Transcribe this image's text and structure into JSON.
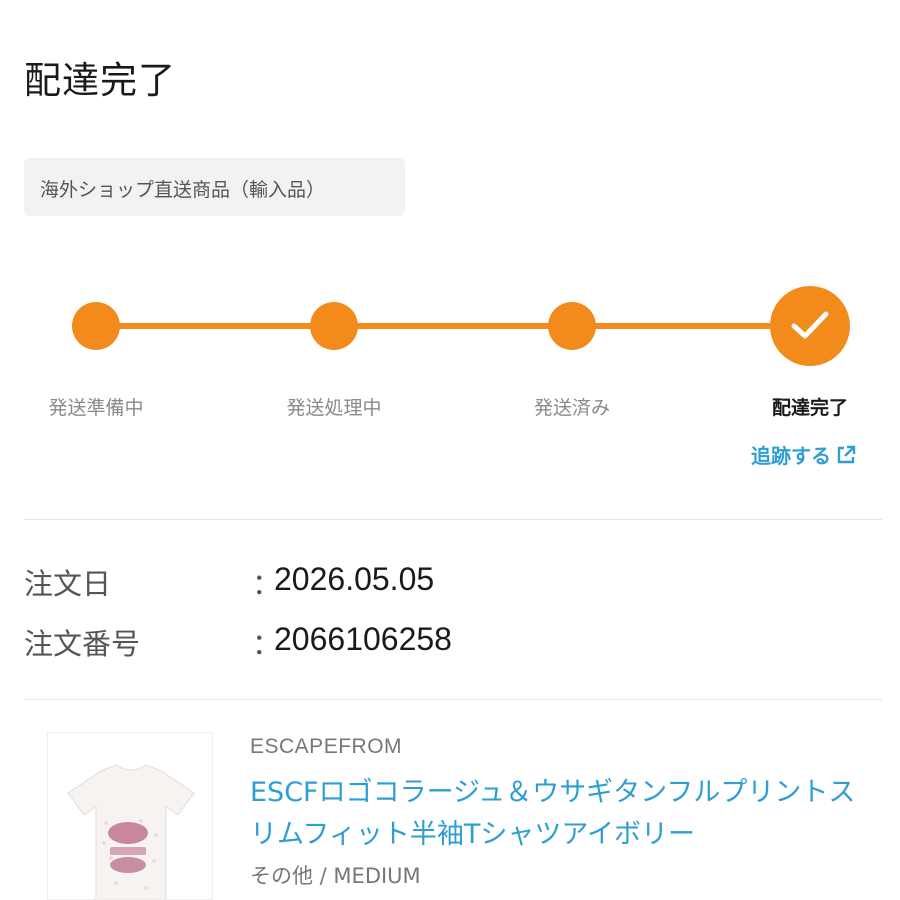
{
  "page": {
    "title": "配達完了"
  },
  "shop_tag": {
    "label": "海外ショップ直送商品（輸入品）"
  },
  "progress": {
    "steps": [
      {
        "label": "発送準備中",
        "state": "done"
      },
      {
        "label": "発送処理中",
        "state": "done"
      },
      {
        "label": "発送済み",
        "state": "done"
      },
      {
        "label": "配達完了",
        "state": "current"
      }
    ],
    "track_label": "追跡する",
    "accent_color": "#f28a1c",
    "link_color": "#2f9ed4"
  },
  "order": {
    "date_label": "注文日",
    "date_value": "2026.05.05",
    "number_label": "注文番号",
    "number_value": "2066106258",
    "colon": "："
  },
  "product": {
    "brand": "ESCAPEFROM",
    "name": "ESCFロゴコラージュ＆ウサギタンフルプリントスリムフィット半袖Tシャツアイボリー",
    "variant": "その他 / MEDIUM"
  }
}
